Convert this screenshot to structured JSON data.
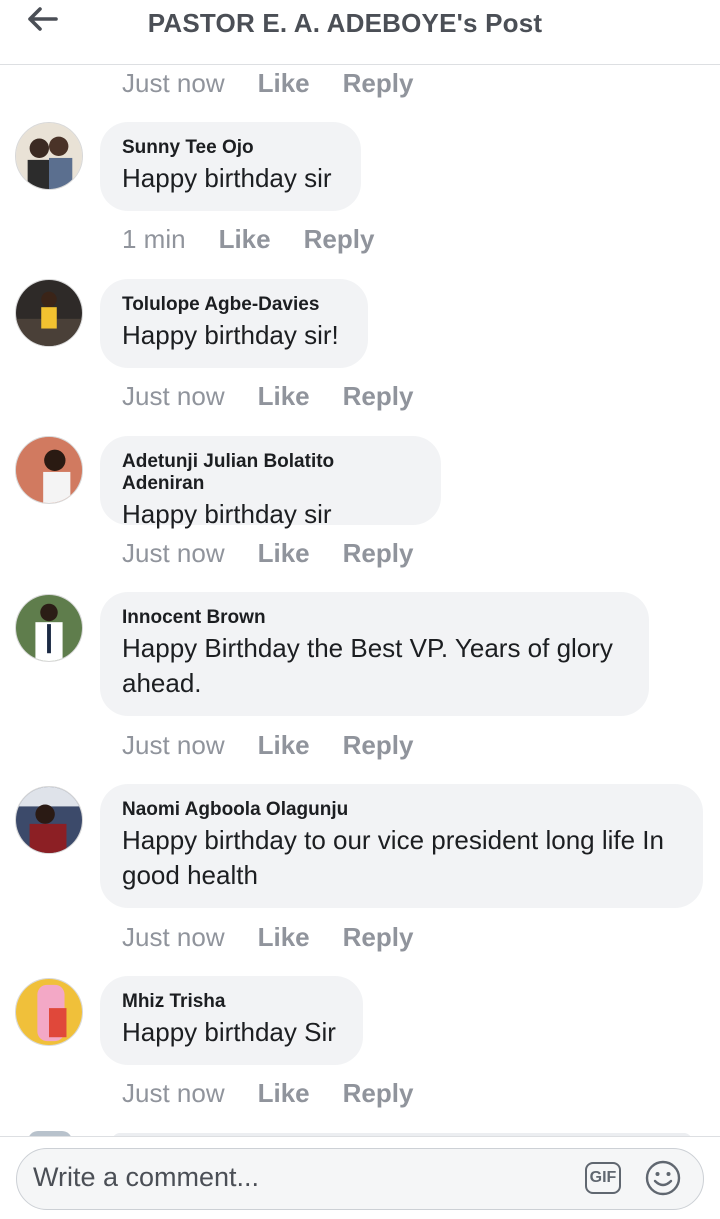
{
  "header": {
    "title": "PASTOR E. A. ADEBOYE's Post",
    "back_icon": "back-arrow-icon"
  },
  "top_actions": {
    "time": "Just now",
    "like": "Like",
    "reply": "Reply"
  },
  "comments": [
    {
      "author": "Sunny Tee Ojo",
      "text": "Happy birthday sir",
      "time": "1 min",
      "like": "Like",
      "reply": "Reply"
    },
    {
      "author": "Tolulope Agbe-Davies",
      "text": "Happy birthday sir!",
      "time": "Just now",
      "like": "Like",
      "reply": "Reply"
    },
    {
      "author": "Adetunji Julian Bolatito Adeniran",
      "text": "Happy birthday sir",
      "time": "Just now",
      "like": "Like",
      "reply": "Reply"
    },
    {
      "author": "Innocent Brown",
      "text": "Happy Birthday the Best VP. Years of glory ahead.",
      "time": "Just now",
      "like": "Like",
      "reply": "Reply"
    },
    {
      "author": "Naomi Agboola Olagunju",
      "text": "Happy birthday to our vice president long life In good health",
      "time": "Just now",
      "like": "Like",
      "reply": "Reply"
    },
    {
      "author": "Mhiz Trisha",
      "text": "Happy birthday Sir",
      "time": "Just now",
      "like": "Like",
      "reply": "Reply"
    }
  ],
  "composer": {
    "placeholder": "Write a comment...",
    "gif_label": "GIF",
    "emoji_icon": "emoji-icon"
  },
  "colors": {
    "meta_text": "#90949c",
    "bubble_bg": "#f2f3f5",
    "header_text": "#4b4f56"
  }
}
